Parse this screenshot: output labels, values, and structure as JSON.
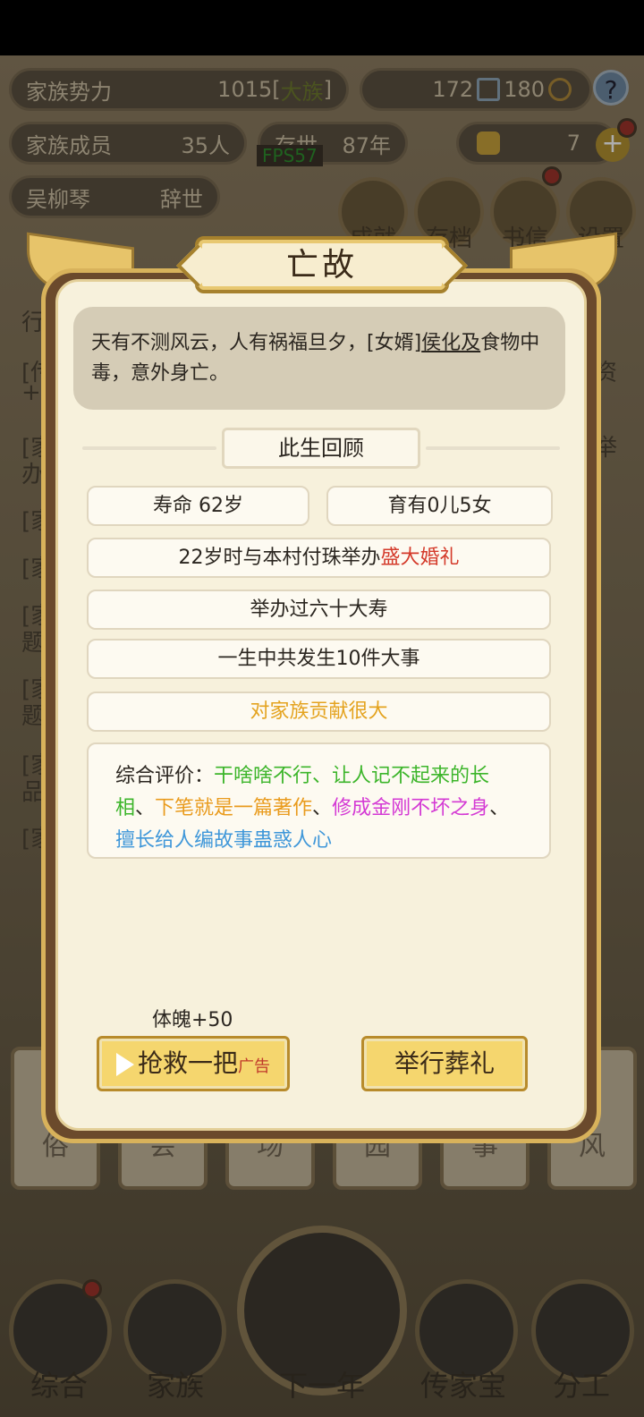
{
  "hud": {
    "clan_power_label": "家族势力",
    "clan_power_value": "1015",
    "clan_power_bracket_open": "[",
    "clan_power_rank": "大族",
    "clan_power_bracket_close": "]",
    "resource_a": "172",
    "resource_b": "180",
    "members_label": "家族成员",
    "members_value": "35人",
    "alive_label": "存世",
    "alive_value": "87年",
    "gold_value": "7",
    "person_name": "吴柳琴",
    "person_status": "辞世",
    "fps": "FPS57",
    "menu": [
      "成就",
      "存档",
      "书信",
      "设置"
    ]
  },
  "background_list": [
    "行",
    "[传",
    "+4",
    "[家",
    "办",
    "[家",
    "[家",
    "[家",
    "题",
    "[家",
    "题",
    "[家",
    "品",
    "[家"
  ],
  "background_list_right": [
    "资",
    "举"
  ],
  "bottom_tiles": [
    "俗",
    "会",
    "场",
    "园",
    "事",
    "风"
  ],
  "bottom_nav": [
    "综合",
    "家族",
    "下一年",
    "传家宝",
    "分工"
  ],
  "dialog": {
    "title": "亡故",
    "description_a": "天有不测风云，人有祸福旦夕，[女婿]",
    "description_name": "侯化及",
    "description_b": "食物中毒，意外身亡。",
    "section_title": "此生回顾",
    "lifespan": "寿命 62岁",
    "children": "育有0儿5女",
    "wedding_a": "22岁时与本村付珠举办",
    "wedding_b": "盛大婚礼",
    "birthday": "举办过六十大寿",
    "events": "一生中共发生10件大事",
    "contribution": "对家族贡献很大",
    "eval_label": "综合评价：",
    "eval_trait1": "干啥啥不行、让人记不起来的长相",
    "sep": "、",
    "eval_trait2": "下笔就是一篇著作",
    "eval_trait3": "修成金刚不坏之身",
    "eval_trait4": "擅长给人编故事蛊惑人心",
    "rescue_hint": "体魄+50",
    "rescue_label": "抢救一把",
    "rescue_ad": "广告",
    "funeral_label": "举行葬礼"
  }
}
